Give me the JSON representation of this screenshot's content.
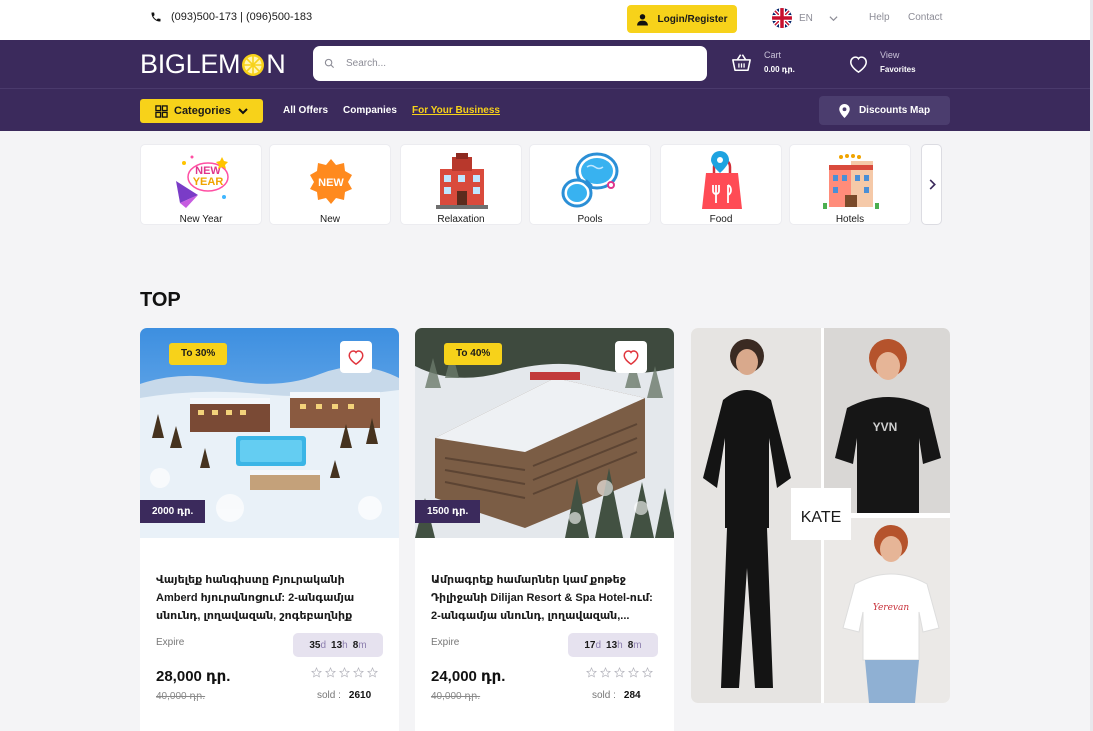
{
  "topbar": {
    "phones": "(093)500-173 | (096)500-183",
    "login_label": "Login/Register",
    "language": "EN",
    "help": "Help",
    "contact": "Contact"
  },
  "header": {
    "logo_left": "BIGLEM",
    "logo_right": "N",
    "search_placeholder": "Search...",
    "cart_label": "Cart",
    "cart_total": "0.00 դր.",
    "favorites_top": "View",
    "favorites_bottom": "Favorites"
  },
  "nav": {
    "categories_label": "Categories",
    "links": [
      "All Offers",
      "Companies",
      "For Your Business"
    ],
    "map_label": "Discounts Map"
  },
  "categories": [
    {
      "label": "New Year",
      "icon": "new-year-icon"
    },
    {
      "label": "New",
      "icon": "new-badge-icon"
    },
    {
      "label": "Relaxation",
      "icon": "hotel-building-icon"
    },
    {
      "label": "Pools",
      "icon": "pool-icon"
    },
    {
      "label": "Food",
      "icon": "food-bag-icon"
    },
    {
      "label": "Hotels",
      "icon": "hotels-icon"
    }
  ],
  "section_title": "TOP",
  "deals": [
    {
      "discount": "To 30%",
      "tag_price": "2000 դր.",
      "title": "Վայելեք հանգիստը Բյուրականի Amberd հյուրանոցում: 2-անգամյա սնունդ, լողավազան, շոգեբաղնիք",
      "expire": "Expire",
      "timer": {
        "d": "35",
        "h": "13",
        "m": "8"
      },
      "price": "28,000 դր.",
      "old_price": "40,000 դր.",
      "sold_label": "sold :",
      "sold": "2610",
      "rating": 0
    },
    {
      "discount": "To 40%",
      "tag_price": "1500 դր.",
      "title": "Ամրագրեք համարներ կամ քոթեջ Դիլիջանի Dilijan Resort & Spa Hotel-ում: 2-անգամյա սնունդ, լողավազան,...",
      "expire": "Expire",
      "timer": {
        "d": "17",
        "h": "13",
        "m": "8"
      },
      "price": "24,000 դր.",
      "old_price": "40,000 դր.",
      "sold_label": "sold :",
      "sold": "284",
      "rating": 0
    }
  ],
  "timer_units": {
    "d": "d",
    "h": "h",
    "m": "m"
  },
  "banner": {
    "brand": "KATE",
    "shirt_text_1": "YVN",
    "shirt_text_2": "Yerevan"
  },
  "colors": {
    "brand": "#3b2a5c",
    "accent": "#f7d21a"
  }
}
